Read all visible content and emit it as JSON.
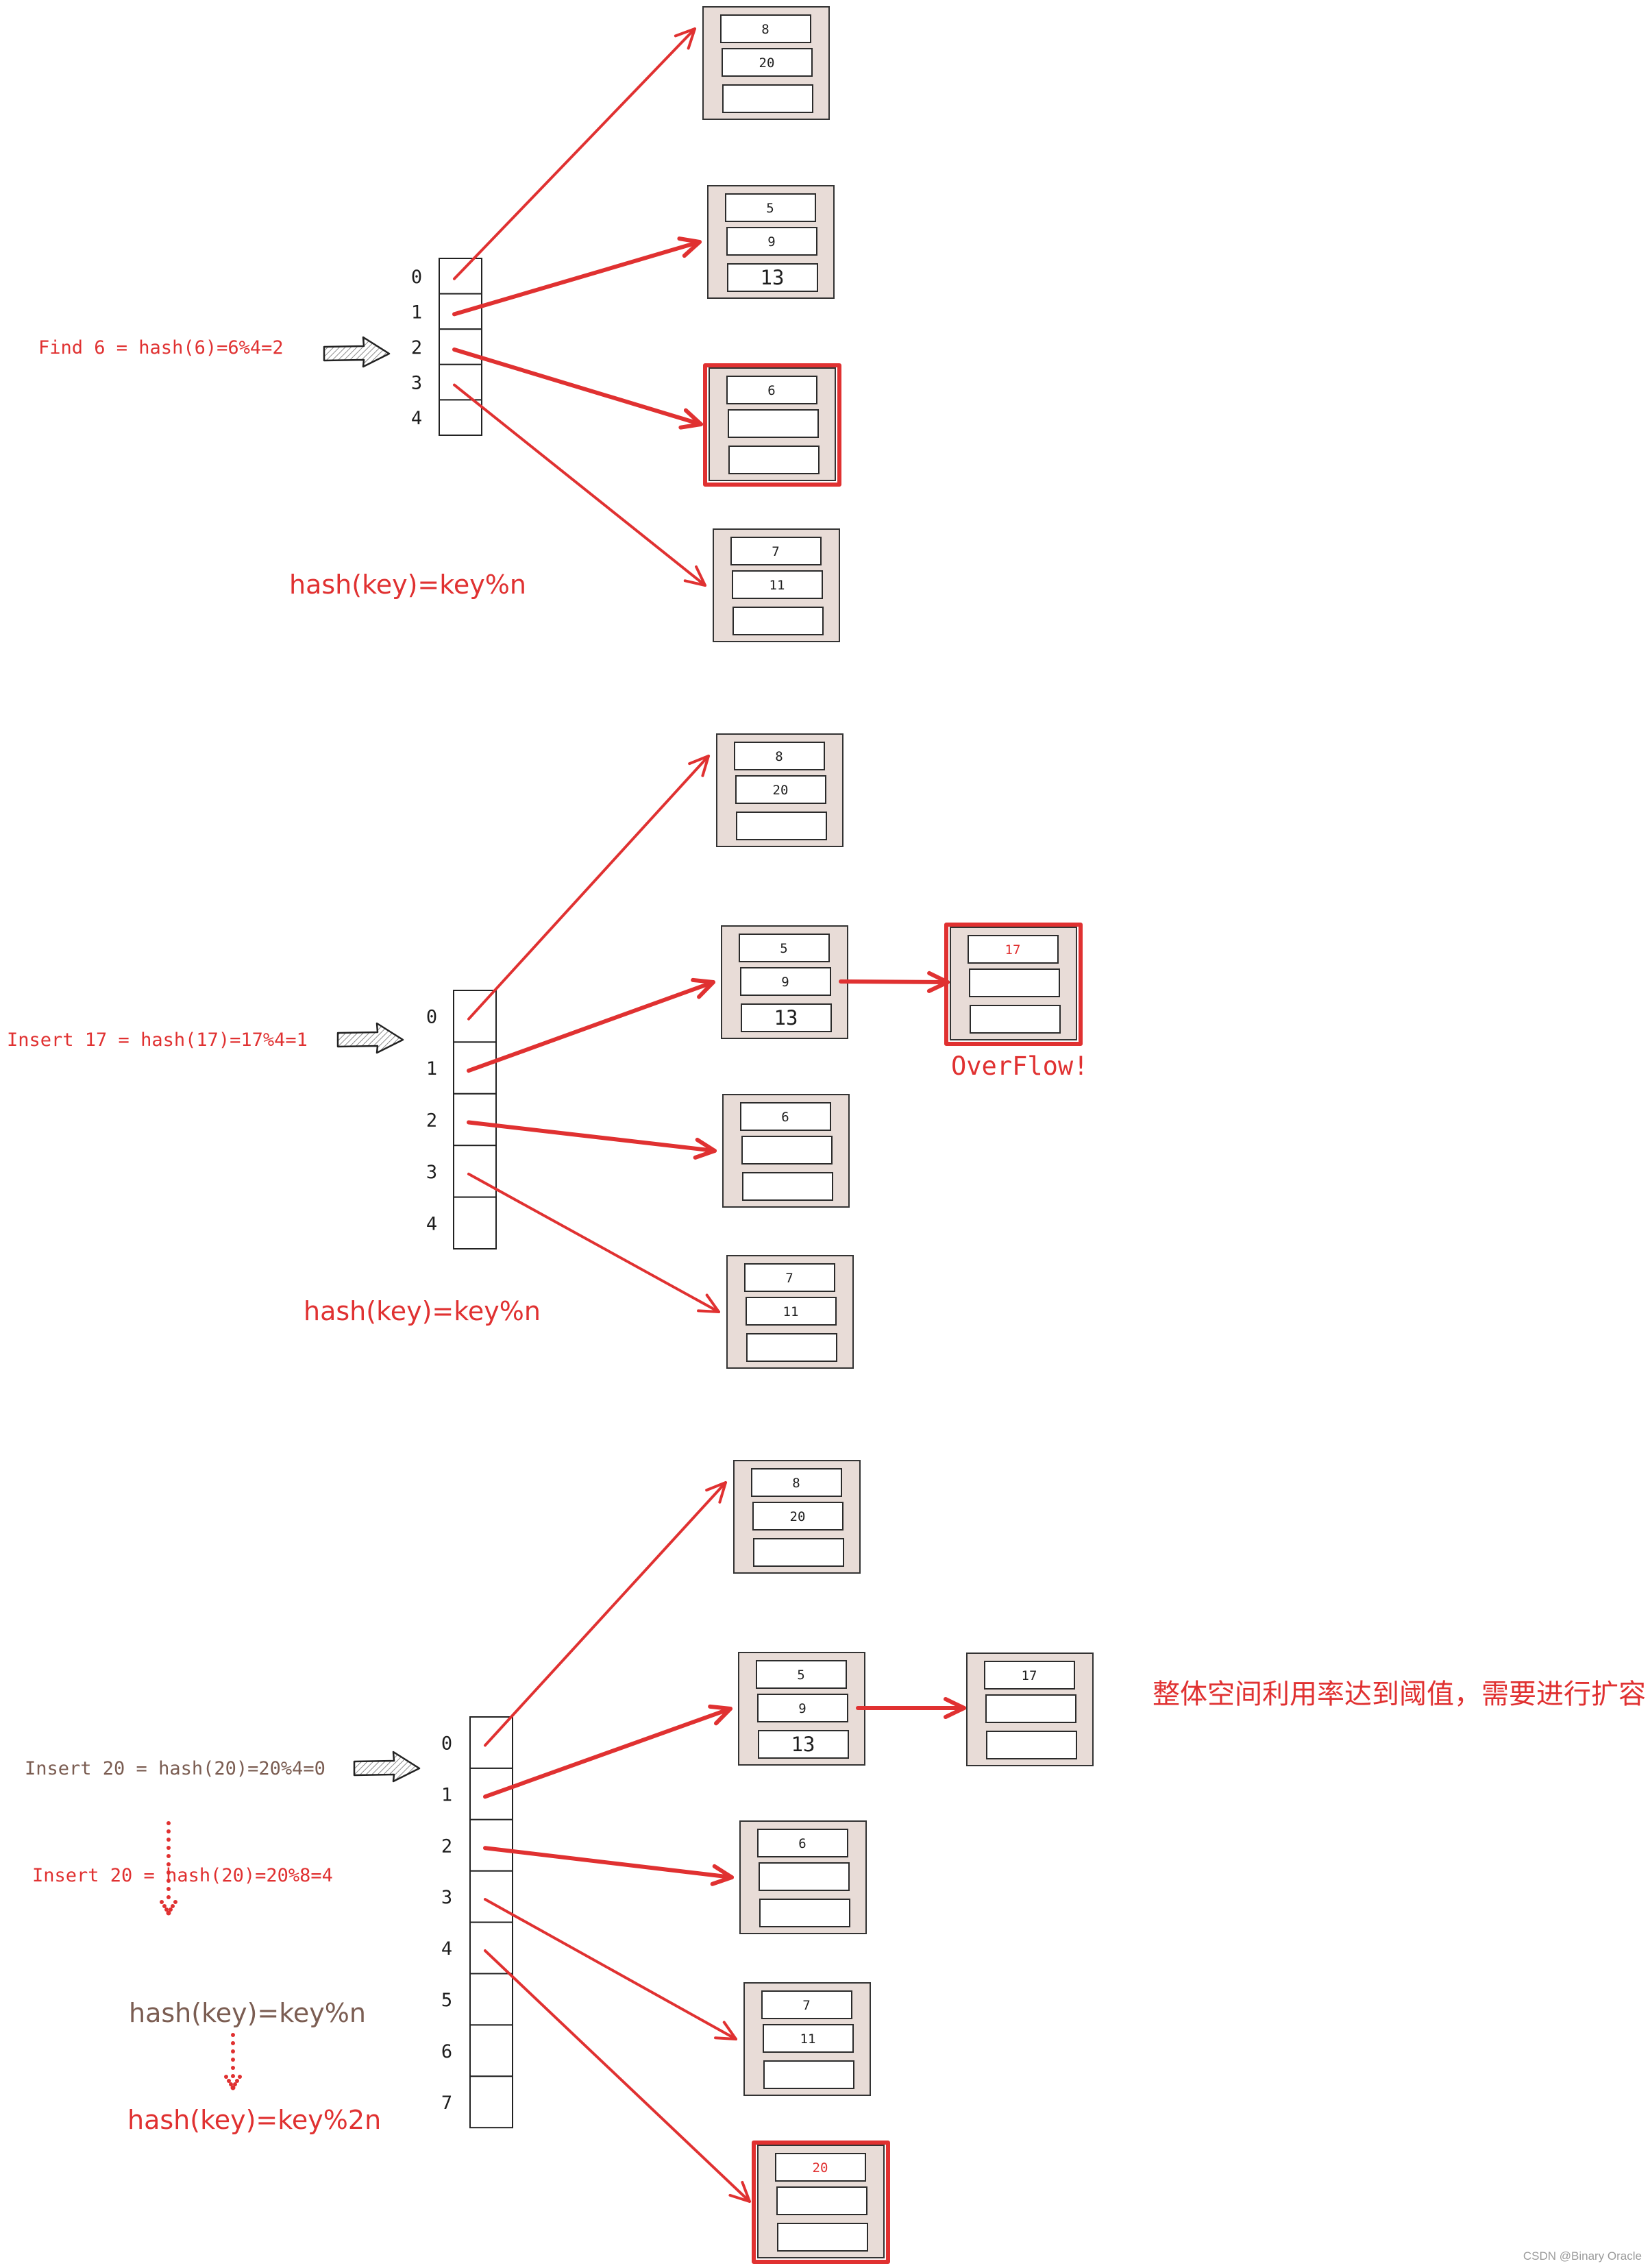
{
  "colors": {
    "accent_red": "#e03131",
    "brown_text": "#7b5d52",
    "ink": "#1e1e1e",
    "bucket_fill": "#e8dcd7",
    "slot_fill": "#ffffff",
    "watermark": "#9a9a9a"
  },
  "sections": [
    {
      "id": "find",
      "operation_text": "Find 6 = hash(6)=6%4=2",
      "operation_color": "red",
      "hash_formula": "hash(key)=key%n",
      "hash_formula_color": "red",
      "array_indices": [
        "0",
        "1",
        "2",
        "3",
        "4"
      ],
      "highlight_index": 2,
      "buckets": [
        {
          "index": 0,
          "slots": [
            "8",
            "20",
            ""
          ],
          "highlighted": false
        },
        {
          "index": 1,
          "slots": [
            "5",
            "9",
            "13"
          ],
          "highlighted": false
        },
        {
          "index": 2,
          "slots": [
            "6",
            "",
            ""
          ],
          "highlighted": true
        },
        {
          "index": 3,
          "slots": [
            "7",
            "11",
            ""
          ],
          "highlighted": false
        }
      ]
    },
    {
      "id": "insert-17",
      "operation_text": "Insert 17 = hash(17)=17%4=1",
      "operation_color": "red",
      "hash_formula": "hash(key)=key%n",
      "hash_formula_color": "red",
      "array_indices": [
        "0",
        "1",
        "2",
        "3",
        "4"
      ],
      "highlight_index": 1,
      "buckets": [
        {
          "index": 0,
          "slots": [
            "8",
            "20",
            ""
          ],
          "highlighted": false
        },
        {
          "index": 1,
          "slots": [
            "5",
            "9",
            "13"
          ],
          "highlighted": false
        },
        {
          "index": 2,
          "slots": [
            "6",
            "",
            ""
          ],
          "highlighted": false
        },
        {
          "index": 3,
          "slots": [
            "7",
            "11",
            ""
          ],
          "highlighted": false
        }
      ],
      "overflow_bucket": {
        "from_bucket": 1,
        "slots": [
          "17",
          "",
          ""
        ],
        "highlighted": true,
        "new_value_red": true
      },
      "overflow_label": "OverFlow!"
    },
    {
      "id": "insert-20",
      "operation_text": "Insert 20 = hash(20)=20%4=0",
      "operation_color": "brown",
      "operation_text_after": "Insert 20 = hash(20)=20%8=4",
      "operation_after_color": "red",
      "hash_formula": "hash(key)=key%n",
      "hash_formula_color": "brown",
      "hash_formula_after": "hash(key)=key%2n",
      "hash_formula_after_color": "red",
      "array_indices": [
        "0",
        "1",
        "2",
        "3",
        "4",
        "5",
        "6",
        "7"
      ],
      "highlight_index": 4,
      "buckets": [
        {
          "index": 0,
          "slots": [
            "8",
            "20",
            ""
          ],
          "highlighted": false
        },
        {
          "index": 1,
          "slots": [
            "5",
            "9",
            "13"
          ],
          "highlighted": false
        },
        {
          "index": 2,
          "slots": [
            "6",
            "",
            ""
          ],
          "highlighted": false
        },
        {
          "index": 3,
          "slots": [
            "7",
            "11",
            ""
          ],
          "highlighted": false
        },
        {
          "index": 4,
          "slots": [
            "20",
            "",
            ""
          ],
          "highlighted": true,
          "new_value_red": true
        }
      ],
      "overflow_bucket": {
        "from_bucket": 1,
        "slots": [
          "17",
          "",
          ""
        ],
        "highlighted": false,
        "new_value_red": false
      },
      "expansion_note": "整体空间利用率达到阈值，需要进行扩容"
    }
  ],
  "watermark": "CSDN @Binary Oracle"
}
